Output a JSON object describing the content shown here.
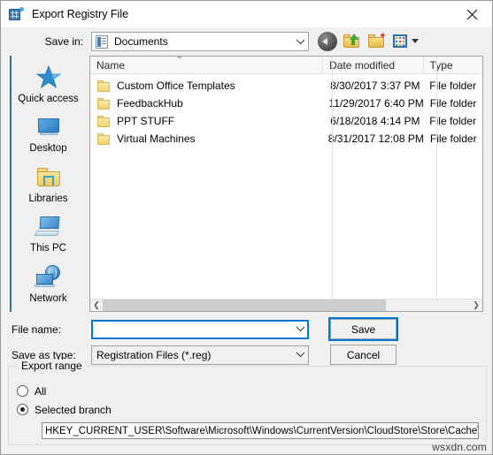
{
  "window": {
    "title": "Export Registry File",
    "icon": "registry-editor-icon",
    "close_label": "✕"
  },
  "savein": {
    "label": "Save in:",
    "value": "Documents",
    "icon": "documents-folder-icon",
    "dropdown_icon": "chevron-down-icon"
  },
  "toolbar": {
    "back": "back-icon",
    "up": "up-one-level-icon",
    "new_folder": "new-folder-icon",
    "views": "views-icon",
    "views_caret": "caret-down-icon"
  },
  "places": {
    "items": [
      {
        "label": "Quick access",
        "icon": "quick-access-star-icon"
      },
      {
        "label": "Desktop",
        "icon": "desktop-monitor-icon"
      },
      {
        "label": "Libraries",
        "icon": "libraries-folder-icon"
      },
      {
        "label": "This PC",
        "icon": "this-pc-icon"
      },
      {
        "label": "Network",
        "icon": "network-globe-icon"
      }
    ]
  },
  "file_list": {
    "columns": [
      "Name",
      "Date modified",
      "Type"
    ],
    "sort_indicator": "⌃",
    "rows": [
      {
        "name": "Custom Office Templates",
        "date": "8/30/2017 3:37 PM",
        "type": "File folder",
        "icon": "folder-icon"
      },
      {
        "name": "FeedbackHub",
        "date": "11/29/2017 6:40 PM",
        "type": "File folder",
        "icon": "folder-icon"
      },
      {
        "name": "PPT STUFF",
        "date": "6/18/2018 4:14 PM",
        "type": "File folder",
        "icon": "folder-icon"
      },
      {
        "name": "Virtual Machines",
        "date": "8/31/2017 12:08 PM",
        "type": "File folder",
        "icon": "folder-icon"
      }
    ],
    "scroll_left_icon": "❮",
    "scroll_right_icon": "❯"
  },
  "form": {
    "filename_label": "File name:",
    "filename_value": "",
    "filename_placeholder": "",
    "savetype_label": "Save as type:",
    "savetype_value": "Registration Files (*.reg)",
    "save_button": "Save",
    "cancel_button": "Cancel",
    "dropdown_icon": "chevron-down-icon"
  },
  "export_range": {
    "legend": "Export range",
    "options": [
      {
        "label": "All",
        "checked": false
      },
      {
        "label": "Selected branch",
        "checked": true
      }
    ],
    "branch_path": "HKEY_CURRENT_USER\\Software\\Microsoft\\Windows\\CurrentVersion\\CloudStore\\Store\\Cache\\Def"
  },
  "watermark": "wsxdn.com",
  "colors": {
    "accent": "#0078d7",
    "places_rail": "#2f6fa8",
    "dialog_bg": "#f0f0f0",
    "list_bg": "#ffffff",
    "folder_yellow": "#f3d271"
  }
}
